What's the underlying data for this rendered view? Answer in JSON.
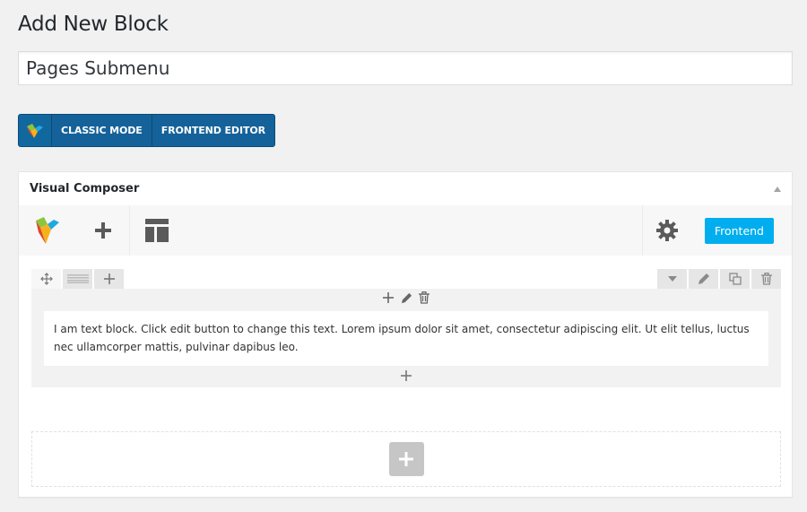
{
  "page": {
    "title": "Add New Block"
  },
  "post": {
    "title_value": "Pages Submenu"
  },
  "mode_switch": {
    "classic_label": "CLASSIC MODE",
    "frontend_label": "FRONTEND EDITOR"
  },
  "composer": {
    "box_title": "Visual Composer",
    "frontend_button": "Frontend",
    "accent_color": "#00aeef",
    "text_block": "I am text block. Click edit button to change this text. Lorem ipsum dolor sit amet, consectetur adipiscing elit. Ut elit tellus, luctus nec ullamcorper mattis, pulvinar dapibus leo."
  }
}
